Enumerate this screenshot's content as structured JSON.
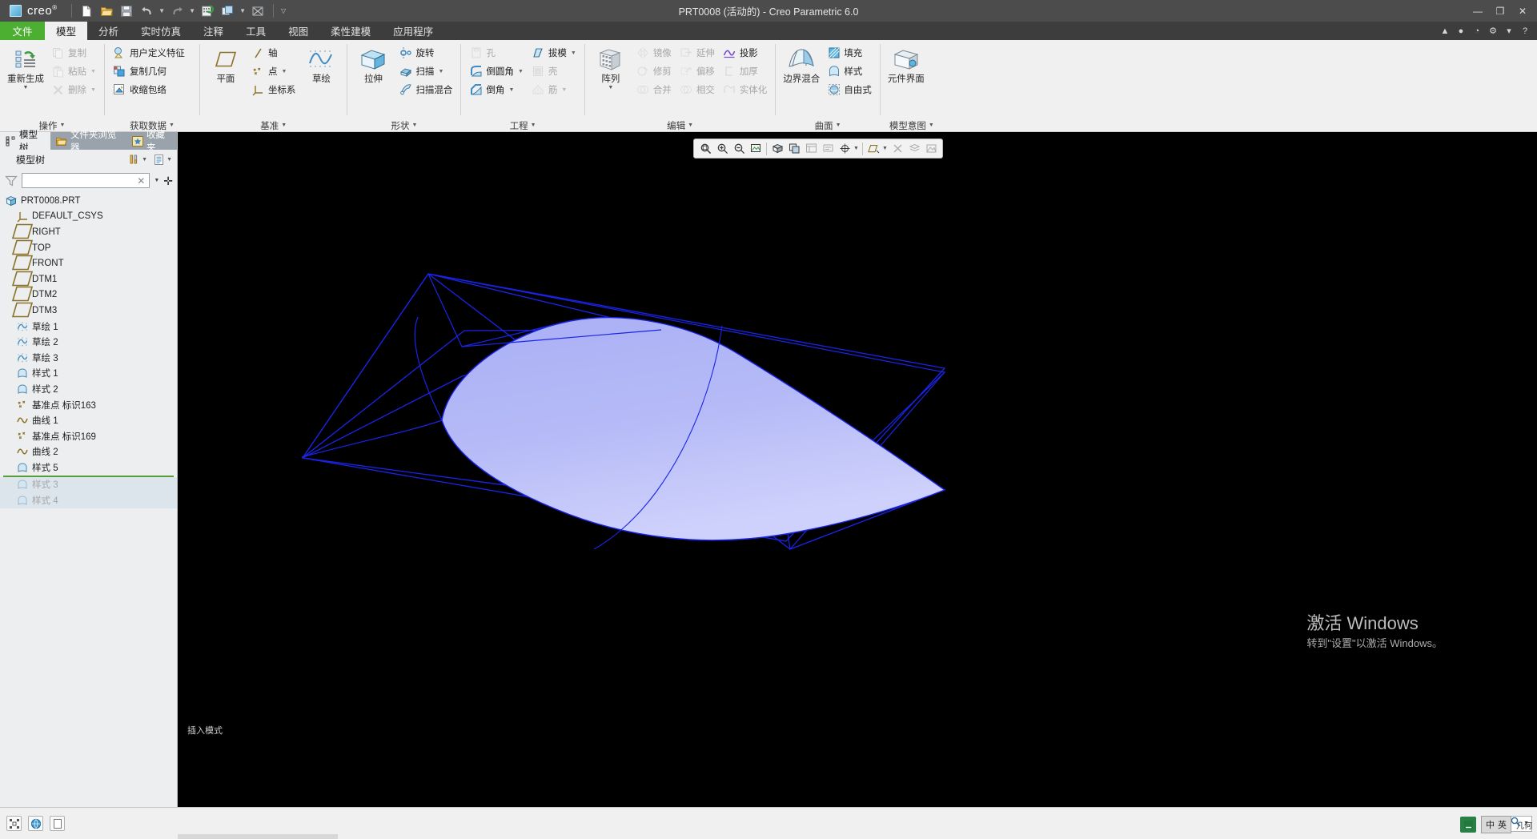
{
  "titlebar": {
    "app_name": "creo",
    "app_mark": "®",
    "window_title": "PRT0008 (活动的) - Creo Parametric 6.0",
    "quick_access": [
      {
        "name": "new-file-icon",
        "tip": "新建"
      },
      {
        "name": "open-file-icon",
        "tip": "打开"
      },
      {
        "name": "save-icon",
        "tip": "保存"
      },
      {
        "name": "undo-icon",
        "tip": "撤消"
      },
      {
        "name": "redo-icon",
        "tip": "重做"
      },
      {
        "name": "regenerate-icon",
        "tip": "重新生成"
      },
      {
        "name": "window-switch-icon",
        "tip": "窗口"
      },
      {
        "name": "close-window-icon",
        "tip": "关闭"
      }
    ],
    "win_minimize": "—",
    "win_maximize": "❐",
    "win_close": "✕",
    "help_icon": "?"
  },
  "tabs": [
    {
      "label": "文件",
      "state": "file"
    },
    {
      "label": "模型",
      "state": "active"
    },
    {
      "label": "分析",
      "state": "normal"
    },
    {
      "label": "实时仿真",
      "state": "normal"
    },
    {
      "label": "注释",
      "state": "normal"
    },
    {
      "label": "工具",
      "state": "normal"
    },
    {
      "label": "视图",
      "state": "normal"
    },
    {
      "label": "柔性建模",
      "state": "normal"
    },
    {
      "label": "应用程序",
      "state": "normal"
    }
  ],
  "ribbon": {
    "groups": [
      {
        "label": "操作",
        "big": {
          "label": "重新生成",
          "icon": "regenerate-icon",
          "dropdown": true
        },
        "columns": [
          {
            "items": [
              {
                "label": "复制",
                "icon": "copy-icon",
                "disabled": true,
                "dropdown": false
              },
              {
                "label": "粘贴",
                "icon": "paste-icon",
                "disabled": true,
                "dropdown": true
              },
              {
                "label": "删除",
                "icon": "delete-icon",
                "disabled": true,
                "dropdown": true
              }
            ]
          }
        ]
      },
      {
        "label": "获取数据",
        "columns": [
          {
            "items": [
              {
                "label": "用户定义特征",
                "icon": "udf-icon",
                "disabled": false,
                "dropdown": false
              },
              {
                "label": "复制几何",
                "icon": "copy-geometry-icon",
                "disabled": false,
                "dropdown": false
              },
              {
                "label": "收缩包络",
                "icon": "shrinkwrap-icon",
                "disabled": false,
                "dropdown": false
              }
            ]
          }
        ]
      },
      {
        "label": "基准",
        "big": {
          "label": "平面",
          "icon": "datum-plane-icon",
          "dropdown": false
        },
        "columns": [
          {
            "items": [
              {
                "label": "轴",
                "icon": "datum-axis-icon",
                "disabled": false,
                "dropdown": false
              },
              {
                "label": "点",
                "icon": "datum-point-icon",
                "disabled": false,
                "dropdown": true
              },
              {
                "label": "坐标系",
                "icon": "coordinate-system-icon",
                "disabled": false,
                "dropdown": false
              }
            ]
          }
        ],
        "big2": {
          "label": "草绘",
          "icon": "sketch-icon",
          "dropdown": false
        }
      },
      {
        "label": "形状",
        "big": {
          "label": "拉伸",
          "icon": "extrude-icon",
          "dropdown": false
        },
        "columns": [
          {
            "items": [
              {
                "label": "旋转",
                "icon": "revolve-icon",
                "disabled": false,
                "dropdown": false
              },
              {
                "label": "扫描",
                "icon": "sweep-icon",
                "disabled": false,
                "dropdown": true
              },
              {
                "label": "扫描混合",
                "icon": "swept-blend-icon",
                "disabled": false,
                "dropdown": false
              }
            ]
          }
        ]
      },
      {
        "label": "工程",
        "columns": [
          {
            "items": [
              {
                "label": "孔",
                "icon": "hole-icon",
                "disabled": true,
                "dropdown": false
              },
              {
                "label": "倒圆角",
                "icon": "round-icon",
                "disabled": false,
                "dropdown": true
              },
              {
                "label": "倒角",
                "icon": "chamfer-icon",
                "disabled": false,
                "dropdown": true
              }
            ]
          },
          {
            "items": [
              {
                "label": "拔模",
                "icon": "draft-icon",
                "disabled": false,
                "dropdown": true
              },
              {
                "label": "壳",
                "icon": "shell-icon",
                "disabled": true,
                "dropdown": false
              },
              {
                "label": "筋",
                "icon": "rib-icon",
                "disabled": true,
                "dropdown": true
              }
            ]
          }
        ]
      },
      {
        "label": "编辑",
        "big": {
          "label": "阵列",
          "icon": "pattern-icon",
          "dropdown": true
        },
        "columns": [
          {
            "items": [
              {
                "label": "镜像",
                "icon": "mirror-icon",
                "disabled": true,
                "dropdown": false
              },
              {
                "label": "修剪",
                "icon": "trim-icon",
                "disabled": true,
                "dropdown": false
              },
              {
                "label": "合并",
                "icon": "merge-icon",
                "disabled": true,
                "dropdown": false
              }
            ]
          },
          {
            "items": [
              {
                "label": "延伸",
                "icon": "extend-icon",
                "disabled": true,
                "dropdown": false
              },
              {
                "label": "偏移",
                "icon": "offset-icon",
                "disabled": true,
                "dropdown": false
              },
              {
                "label": "相交",
                "icon": "intersect-icon",
                "disabled": true,
                "dropdown": false
              }
            ]
          },
          {
            "items": [
              {
                "label": "投影",
                "icon": "project-icon",
                "disabled": false,
                "dropdown": false
              },
              {
                "label": "加厚",
                "icon": "thicken-icon",
                "disabled": true,
                "dropdown": false
              },
              {
                "label": "实体化",
                "icon": "solidify-icon",
                "disabled": true,
                "dropdown": false
              }
            ]
          }
        ]
      },
      {
        "label": "曲面",
        "big": {
          "label": "边界混合",
          "icon": "boundary-blend-icon",
          "dropdown": false
        },
        "columns": [
          {
            "items": [
              {
                "label": "填充",
                "icon": "fill-icon",
                "disabled": false,
                "dropdown": false
              },
              {
                "label": "样式",
                "icon": "style-icon",
                "disabled": false,
                "dropdown": false
              },
              {
                "label": "自由式",
                "icon": "freestyle-icon",
                "disabled": false,
                "dropdown": false
              }
            ]
          }
        ]
      },
      {
        "label": "模型意图",
        "big": {
          "label": "元件界面",
          "icon": "component-interface-icon",
          "dropdown": false
        },
        "columns": []
      }
    ]
  },
  "left_panel": {
    "nav_tabs": [
      {
        "label": "模型树",
        "icon": "model-tree-icon",
        "active": true
      },
      {
        "label": "文件夹浏览器",
        "icon": "folder-browser-icon",
        "active": false
      },
      {
        "label": "收藏夹",
        "icon": "favorites-icon",
        "active": false
      }
    ],
    "tree_header": {
      "title": "模型树",
      "settings_icon": "tools-icon",
      "display_icon": "display-settings-icon"
    },
    "filter": {
      "icon": "filter-icon",
      "value": "",
      "placeholder": "",
      "clear_icon": "clear-icon",
      "dropdown_icon": "chevron-down-icon",
      "add_icon": "plus-icon"
    },
    "tree_items": [
      {
        "label": "PRT0008.PRT",
        "icon": "part-icon",
        "level": 0,
        "state": "normal"
      },
      {
        "label": "DEFAULT_CSYS",
        "icon": "coordinate-system-icon",
        "level": 1,
        "state": "normal"
      },
      {
        "label": "RIGHT",
        "icon": "datum-plane-icon",
        "level": 1,
        "state": "normal"
      },
      {
        "label": "TOP",
        "icon": "datum-plane-icon",
        "level": 1,
        "state": "normal"
      },
      {
        "label": "FRONT",
        "icon": "datum-plane-icon",
        "level": 1,
        "state": "normal"
      },
      {
        "label": "DTM1",
        "icon": "datum-plane-icon",
        "level": 1,
        "state": "normal"
      },
      {
        "label": "DTM2",
        "icon": "datum-plane-icon",
        "level": 1,
        "state": "normal"
      },
      {
        "label": "DTM3",
        "icon": "datum-plane-icon",
        "level": 1,
        "state": "normal"
      },
      {
        "label": "草绘 1",
        "icon": "sketch-feature-icon",
        "level": 1,
        "state": "normal"
      },
      {
        "label": "草绘 2",
        "icon": "sketch-feature-icon",
        "level": 1,
        "state": "normal"
      },
      {
        "label": "草绘 3",
        "icon": "sketch-feature-icon",
        "level": 1,
        "state": "normal"
      },
      {
        "label": "样式 1",
        "icon": "style-feature-icon",
        "level": 1,
        "state": "normal"
      },
      {
        "label": "样式 2",
        "icon": "style-feature-icon",
        "level": 1,
        "state": "normal"
      },
      {
        "label": "基准点 标识163",
        "icon": "datum-point-icon",
        "level": 1,
        "state": "normal"
      },
      {
        "label": "曲线 1",
        "icon": "curve-icon",
        "level": 1,
        "state": "normal"
      },
      {
        "label": "基准点 标识169",
        "icon": "datum-point-icon",
        "level": 1,
        "state": "normal"
      },
      {
        "label": "曲线 2",
        "icon": "curve-icon",
        "level": 1,
        "state": "normal"
      },
      {
        "label": "样式 5",
        "icon": "style-feature-icon",
        "level": 1,
        "state": "normal"
      },
      {
        "label": "样式 3",
        "icon": "style-feature-icon",
        "level": 1,
        "state": "suppressed"
      },
      {
        "label": "样式 4",
        "icon": "style-feature-icon",
        "level": 1,
        "state": "suppressed"
      }
    ]
  },
  "graphics_toolbar": {
    "buttons": [
      {
        "name": "refit-icon",
        "disabled": false
      },
      {
        "name": "zoom-in-icon",
        "disabled": false
      },
      {
        "name": "zoom-out-icon",
        "disabled": false
      },
      {
        "name": "repaint-icon",
        "disabled": false
      },
      {
        "name": "display-style-icon",
        "disabled": false
      },
      {
        "name": "saved-orientations-icon",
        "disabled": false
      },
      {
        "name": "view-manager-icon",
        "disabled": true
      },
      {
        "name": "annotation-display-icon",
        "disabled": true
      },
      {
        "name": "spin-center-icon",
        "disabled": false
      },
      {
        "name": "datum-display-icon",
        "disabled": false
      },
      {
        "name": "section-icon",
        "disabled": true
      },
      {
        "name": "layer-icon",
        "disabled": true
      },
      {
        "name": "perspective-icon",
        "disabled": true
      }
    ]
  },
  "viewport": {
    "insert_mode_label": "插入模式",
    "background": "#000000",
    "surface_fill_top": "#aeb4f5",
    "surface_fill_bottom": "#c9ccfa",
    "curve_color": "#1a24e8",
    "watermark_line1": "激活 Windows",
    "watermark_line2": "转到\"设置\"以激活 Windows。"
  },
  "statusbar": {
    "left_buttons": [
      {
        "name": "selection-filter-icon"
      },
      {
        "name": "globe-icon"
      },
      {
        "name": "page-icon"
      }
    ],
    "search_placeholder": "",
    "search_icon": "search-icon",
    "dropdown_icon": "chevron-down-icon",
    "tray": {
      "app_icon": "app-icon",
      "ime_lang": "中",
      "ime_mode": "英",
      "geometry_label": "几何"
    }
  }
}
